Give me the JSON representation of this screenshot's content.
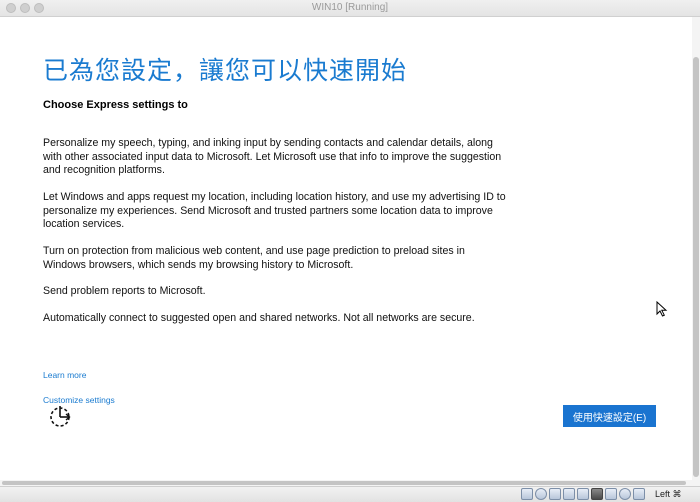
{
  "window": {
    "title": "WIN10 [Running]"
  },
  "setup": {
    "heading": "已為您設定，讓您可以快速開始",
    "subheading": "Choose Express settings to",
    "paragraphs": [
      "Personalize my speech, typing, and inking input by sending contacts and calendar details, along with other associated input data to Microsoft. Let Microsoft use that info to improve the suggestion and recognition platforms.",
      "Let Windows and apps request my location, including location history, and use my advertising ID to personalize my experiences. Send Microsoft and trusted partners some location data to improve location services.",
      "Turn on protection from malicious web content, and use page prediction to preload sites in Windows browsers, which sends my browsing history to Microsoft.",
      "Send problem reports to Microsoft.",
      "Automatically connect to suggested open and shared networks. Not all networks are secure."
    ],
    "learn_more": "Learn more",
    "customize": "Customize settings",
    "express_button": "使用快速設定(E)",
    "accent_color": "#1a7bd0"
  },
  "statusbar": {
    "icons": [
      "hard-disk-icon",
      "optical-disk-icon",
      "usb-icon",
      "shared-folder-icon",
      "display-icon",
      "network-icon",
      "recording-icon",
      "capture-icon",
      "download-icon"
    ],
    "host_key": "Left ⌘"
  }
}
